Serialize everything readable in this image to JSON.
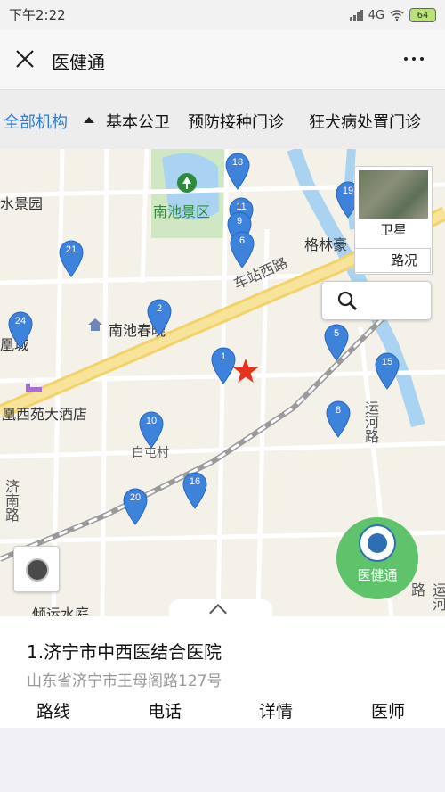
{
  "status_bar": {
    "time": "下午2:22",
    "network": "4G",
    "battery": "64"
  },
  "nav": {
    "title": "医健通",
    "close_icon": "close-icon",
    "more_icon": "more-icon"
  },
  "categories": [
    {
      "label": "全部机构",
      "active": true
    },
    {
      "label": "基本公卫"
    },
    {
      "label": "预防接种门诊"
    },
    {
      "label": "狂犬病处置门诊"
    }
  ],
  "map": {
    "labels": [
      "水景园",
      "南池景区",
      "格林豪",
      "南池春晓",
      "凰城",
      "凰西苑大酒店",
      "白屯村",
      "倾运水庭"
    ],
    "roads": [
      "车站西路",
      "运河路",
      "运河路",
      "济南路"
    ],
    "pins": [
      "18",
      "11",
      "9",
      "6",
      "19",
      "21",
      "24",
      "2",
      "1",
      "5",
      "15",
      "8",
      "10",
      "16",
      "20"
    ],
    "satellite_label": "卫星",
    "traffic_label": "路况"
  },
  "fab": {
    "label": "医健通"
  },
  "result": {
    "name": "1.济宁市中西医结合医院",
    "address": "山东省济宁市王母阁路127号",
    "actions": {
      "route": "路线",
      "phone": "电话",
      "detail": "详情",
      "doctor": "医师"
    }
  },
  "colors": {
    "accent": "#2a7fd4",
    "pin": "#3d82db",
    "fab": "#5ec36a",
    "star": "#e8321e"
  }
}
